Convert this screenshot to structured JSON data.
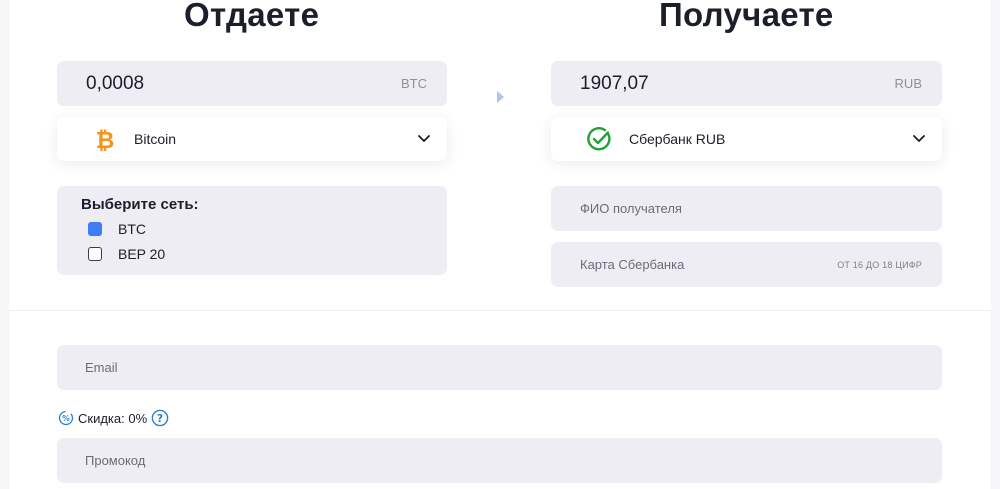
{
  "give": {
    "title": "Отдаете",
    "amount": "0,0008",
    "currency": "BTC",
    "coin_icon": "bitcoin-icon",
    "coin_label": "Bitcoin",
    "network": {
      "title": "Выберите сеть:",
      "options": [
        {
          "label": "BTC",
          "checked": true
        },
        {
          "label": "BEP 20",
          "checked": false
        }
      ]
    }
  },
  "receive": {
    "title": "Получаете",
    "amount": "1907,07",
    "currency": "RUB",
    "bank_icon": "sberbank-icon",
    "bank_label": "Сбербанк RUB",
    "name_placeholder": "ФИО получателя",
    "card_placeholder": "Карта Сбербанка",
    "card_hint": "ОТ 16 ДО 18 ЦИФР"
  },
  "contact": {
    "email_placeholder": "Email",
    "discount_label": "Скидка: 0%",
    "promo_placeholder": "Промокод"
  },
  "colors": {
    "accent": "#3c7ef3",
    "bitcoin": "#f7931a",
    "sber": "#21a038",
    "field_bg": "#ededf3"
  }
}
